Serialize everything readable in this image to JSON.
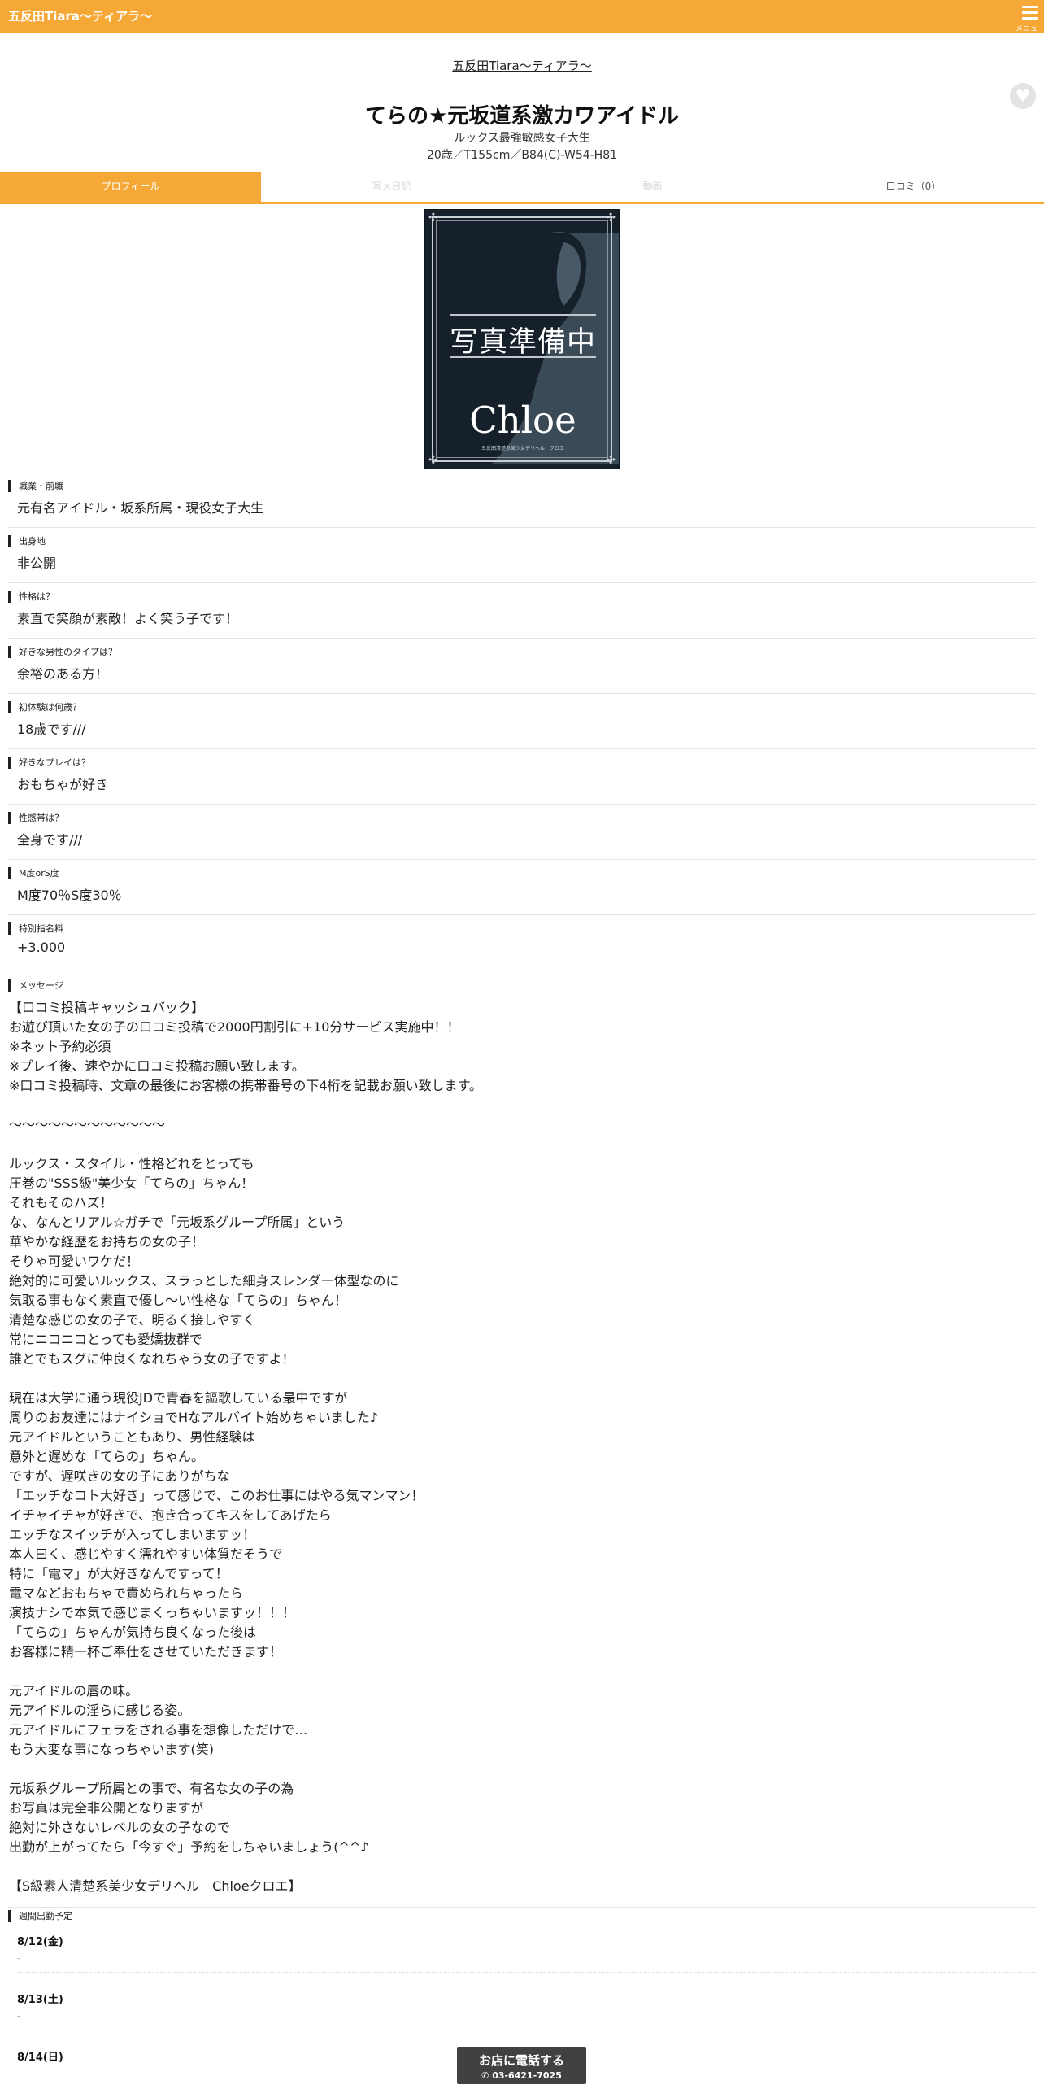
{
  "header": {
    "brand": "五反田Tiara～ティアラ～",
    "menu_label": "メニュー"
  },
  "profile": {
    "shop_link": "五反田Tiara～ティアラ～",
    "name": "てらの★元坂道系激カワアイドル",
    "catchcopy": "ルックス最強敏感女子大生",
    "specs": "20歳／T155cm／B84(C)-W54-H81",
    "favorite_icon": "heart-icon"
  },
  "tabs": [
    {
      "label": "プロフィール",
      "state": "active"
    },
    {
      "label": "写メ日記",
      "state": "disabled"
    },
    {
      "label": "動画",
      "state": "disabled"
    },
    {
      "label": "口コミ（0）",
      "state": "normal"
    }
  ],
  "photo": {
    "placeholder_text": "写真準備中",
    "logo": "Chloe",
    "logo_sub": "五反田清楚系美少女デリヘル　クロエ"
  },
  "fields": [
    {
      "label": "職業・前職",
      "value": "元有名アイドル・坂系所属・現役女子大生"
    },
    {
      "label": "出身地",
      "value": "非公開"
    },
    {
      "label": "性格は？",
      "value": "素直で笑顔が素敵！よく笑う子です！"
    },
    {
      "label": "好きな男性のタイプは？",
      "value": "余裕のある方！"
    },
    {
      "label": "初体験は何歳？",
      "value": "18歳です///"
    },
    {
      "label": "好きなプレイは？",
      "value": "おもちゃが好き"
    },
    {
      "label": "性感帯は？",
      "value": "全身です///"
    },
    {
      "label": "M度orS度",
      "value": "M度70％S度30％"
    },
    {
      "label": "特別指名料",
      "value": "+3.000"
    }
  ],
  "message": {
    "label": "メッセージ",
    "text": "【口コミ投稿キャッシュバック】\nお遊び頂いた女の子の口コミ投稿で2000円割引に+10分サービス実施中！！\n※ネット予約必須\n※プレイ後、速やかに口コミ投稿お願い致します。\n※口コミ投稿時、文章の最後にお客様の携帯番号の下4桁を記載お願い致します。\n\n～～～～～～～～～～～～\n\nルックス・スタイル・性格どれをとっても\n圧巻の\"SSS級\"美少女「てらの」ちゃん！\nそれもそのハズ！\nな、なんとリアル☆ガチで「元坂系グループ所属」という\n華やかな経歴をお持ちの女の子！\nそりゃ可愛いワケだ！\n絶対的に可愛いルックス、スラっとした細身スレンダー体型なのに\n気取る事もなく素直で優し～い性格な「てらの」ちゃん！\n清楚な感じの女の子で、明るく接しやすく\n常にニコニコとっても愛嬌抜群で\n誰とでもスグに仲良くなれちゃう女の子ですよ！\n\n現在は大学に通う現役JDで青春を謳歌している最中ですが\n周りのお友達にはナイショでHなアルバイト始めちゃいました♪\n元アイドルということもあり、男性経験は\n意外と遅めな「てらの」ちゃん。\nですが、遅咲きの女の子にありがちな\n「エッチなコト大好き」って感じで、このお仕事にはやる気マンマン！\nイチャイチャが好きで、抱き合ってキスをしてあげたら\nエッチなスイッチが入ってしまいますッ！\n本人曰く、感じやすく濡れやすい体質だそうで\n特に「電マ」が大好きなんですって！\n電マなどおもちゃで責められちゃったら\n演技ナシで本気で感じまくっちゃいますッ！！！\n「てらの」ちゃんが気持ち良くなった後は\nお客様に精一杯ご奉仕をさせていただきます！\n\n元アイドルの唇の味。\n元アイドルの淫らに感じる姿。\n元アイドルにフェラをされる事を想像しただけで…\nもう大変な事になっちゃいます(笑)\n\n元坂系グループ所属との事で、有名な女の子の為\nお写真は完全非公開となりますが\n絶対に外さないレベルの女の子なので\n出勤が上がってたら「今すぐ」予約をしちゃいましょう(^^♪\n\n【S級素人清楚系美少女デリヘル　Chloeクロエ】"
  },
  "schedule": {
    "label": "週間出勤予定",
    "days": [
      {
        "date": "8/12(金)",
        "time": "-"
      },
      {
        "date": "8/13(土)",
        "time": "-"
      },
      {
        "date": "8/14(日)",
        "time": "-"
      }
    ]
  },
  "call_button": {
    "label": "お店に電話する",
    "tel": "03-6421-7025",
    "icon": "phone-icon"
  },
  "colors": {
    "accent": "#f5a836",
    "call_bg": "#414141"
  }
}
